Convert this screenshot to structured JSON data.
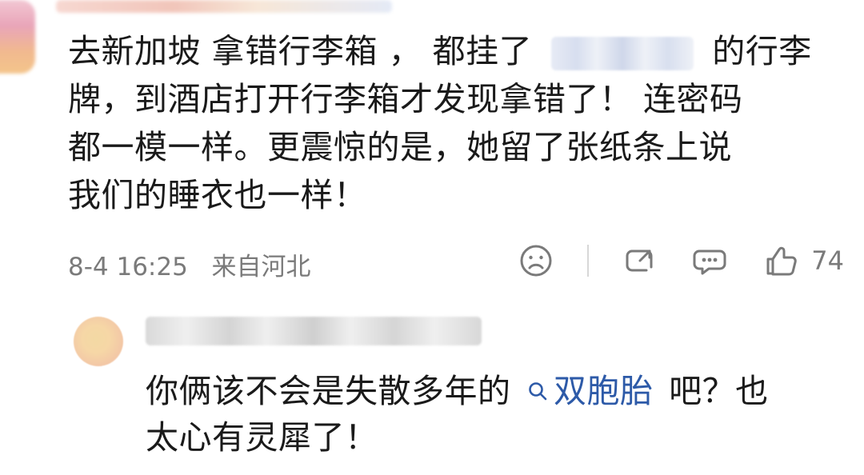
{
  "comment": {
    "lines": [
      {
        "prefix": "去新加坡 拿错行李箱 ， 都挂了",
        "suffix": "的行李"
      },
      "牌，到酒店打开行李箱才发现拿错了！ 连密码",
      "都一模一样。更震惊的是，她留了张纸条上说",
      "我们的睡衣也一样！"
    ],
    "meta": {
      "date_time": "8-4 16:25",
      "location": "来自河北"
    },
    "actions": {
      "like_count": "74",
      "icons": [
        "sad-face-icon",
        "repost-icon",
        "comment-icon",
        "thumbs-up-icon"
      ]
    }
  },
  "reply": {
    "line1_prefix": "你俩该不会是失散多年的",
    "search_term": "双胞胎",
    "line1_suffix": "吧？也",
    "line2": "太心有灵犀了！"
  }
}
